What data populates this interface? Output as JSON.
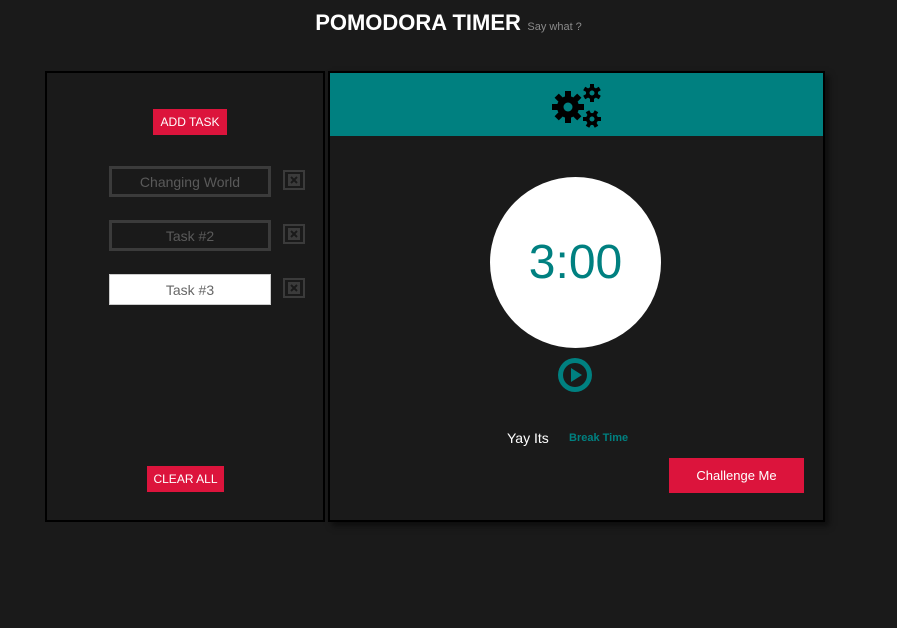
{
  "header": {
    "title": "POMODORA TIMER",
    "subtitle": "Say what ?"
  },
  "tasks_panel": {
    "add_task_label": "ADD TASK",
    "clear_all_label": "CLEAR ALL",
    "tasks": [
      {
        "value": "Changing World",
        "active": false
      },
      {
        "value": "Task #2",
        "active": false
      },
      {
        "value": "Task #3",
        "active": true
      }
    ],
    "delete_icon": "close-icon"
  },
  "timer_panel": {
    "settings_icon": "gears-icon",
    "time": "3:00",
    "play_icon": "play-icon",
    "mode_label": "Yay Its",
    "mode_link": "Break Time",
    "challenge_label": "Challenge Me"
  },
  "colors": {
    "background": "#1a1a1a",
    "accent_teal": "#008080",
    "button_red": "#dc143c"
  }
}
